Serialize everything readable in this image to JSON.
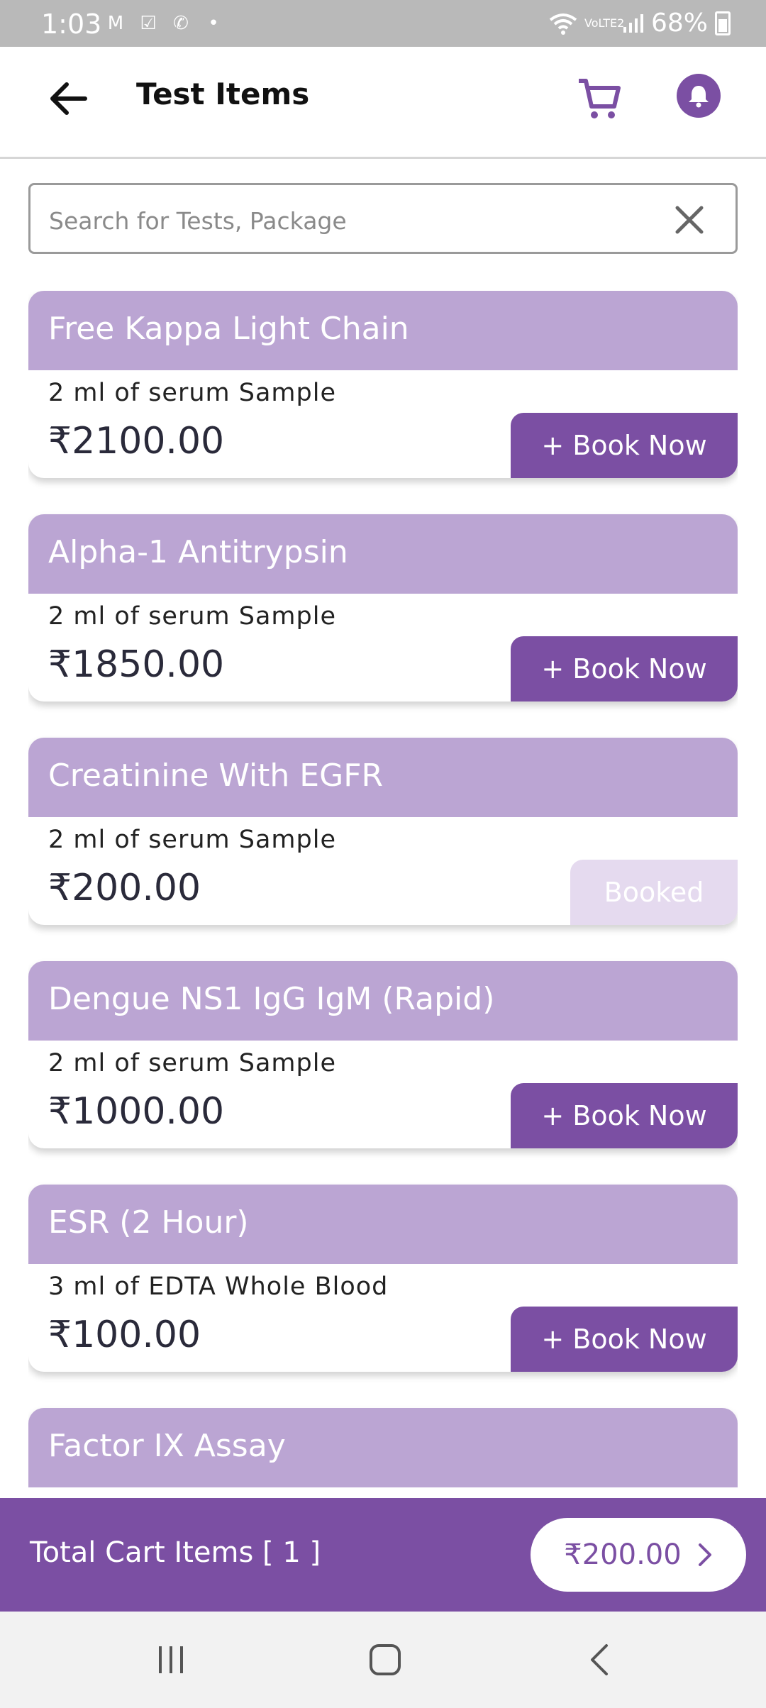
{
  "status_bar": {
    "time": "1:03",
    "battery": "68%",
    "network": "VoLTE2"
  },
  "header": {
    "title": "Test Items",
    "icons": [
      "back-arrow-icon",
      "cart-icon",
      "bell-icon"
    ]
  },
  "search": {
    "placeholder": "Search for Tests, Package",
    "value": ""
  },
  "tests": [
    {
      "name": "Free Kappa Light Chain",
      "sample": "2 ml of serum Sample",
      "price": "₹2100.00",
      "action": "+ Book Now",
      "booked": false
    },
    {
      "name": "Alpha-1 Antitrypsin",
      "sample": "2 ml of serum Sample",
      "price": "₹1850.00",
      "action": "+ Book Now",
      "booked": false
    },
    {
      "name": "Creatinine With EGFR",
      "sample": "2 ml of serum Sample",
      "price": "₹200.00",
      "action": "Booked",
      "booked": true
    },
    {
      "name": "Dengue NS1 IgG IgM (Rapid)",
      "sample": "2 ml of serum Sample",
      "price": "₹1000.00",
      "action": "+ Book Now",
      "booked": false
    },
    {
      "name": "ESR (2 Hour)",
      "sample": "3 ml of EDTA Whole Blood",
      "price": "₹100.00",
      "action": "+ Book Now",
      "booked": false
    },
    {
      "name": "Factor IX Assay",
      "sample": "",
      "price": "",
      "action": "",
      "booked": false
    }
  ],
  "cart_bar": {
    "label": "Total Cart Items [ 1 ]",
    "total": "₹200.00"
  },
  "colors": {
    "primary": "#7b4fa3",
    "card_header": "#bba5d3",
    "booked_bg": "#e5daef"
  }
}
